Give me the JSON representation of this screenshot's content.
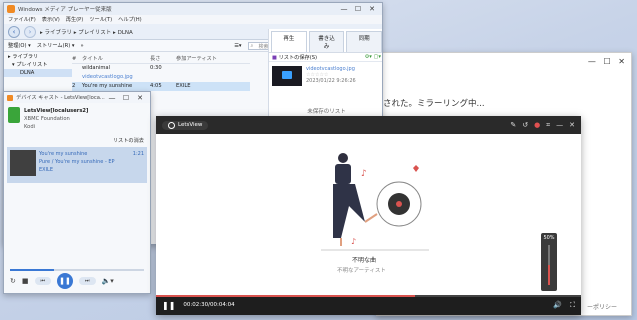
{
  "wmp": {
    "title": "Windows メディア プレーヤー従来版",
    "menu": [
      "ファイル(F)",
      "表示(V)",
      "再生(P)",
      "ツール(T)",
      "ヘルプ(H)"
    ],
    "breadcrumb": [
      "ライブラリ",
      "プレイリスト",
      "DLNA"
    ],
    "toolbar": {
      "organize": "整理(O)",
      "stream": "ストリーム(R)",
      "more": "»",
      "search_placeholder": "検索"
    },
    "tabs": [
      "再生",
      "書き込み",
      "同期"
    ],
    "list_save": "リストの保存(S)",
    "tree": [
      "ライブラリ",
      "プレイリスト",
      "DLNA"
    ],
    "columns": {
      "num": "#",
      "title": "タイトル",
      "length": "長さ",
      "artist": "参加アーティスト"
    },
    "rows": [
      {
        "num": "",
        "title": "wildanimal",
        "length": "0:30",
        "artist": ""
      },
      {
        "num": "",
        "title": "videotvcastlogo.jpg",
        "length": "",
        "artist": ""
      },
      {
        "num": "2",
        "title": "You're my sunshine",
        "length": "4:05",
        "artist": "EXILE"
      }
    ],
    "side_item": {
      "name": "videotvcastlogo.jpg",
      "date": "2023/01/22 9:26:26"
    },
    "unsaved": "未保存のリスト"
  },
  "bg_window": {
    "text": "された。ミラーリング中...",
    "policy": "ーポリシー"
  },
  "device_cast": {
    "title": "デバイス キャスト - LetsView[loca...",
    "device_name": "LetsView[localusers2]",
    "vendor": "XBMC Foundation",
    "model": "Kodi",
    "list_label": "リストの消去",
    "track": {
      "title": "You're my sunshine",
      "album": "Pure / You're my sunshine - EP",
      "artist": "EXILE",
      "time": "1:21"
    },
    "progress": 0.33
  },
  "letsview": {
    "app_name": "LetsView",
    "unknown_song": "不明な曲",
    "unknown_artist": "不明なアーティスト",
    "time_current": "00:02:30",
    "time_total": "/00:04:04",
    "volume_label": "50%",
    "volume": 0.5,
    "progress": 0.61
  },
  "colors": {
    "accent": "#d9534f",
    "link": "#4a7fd0"
  }
}
